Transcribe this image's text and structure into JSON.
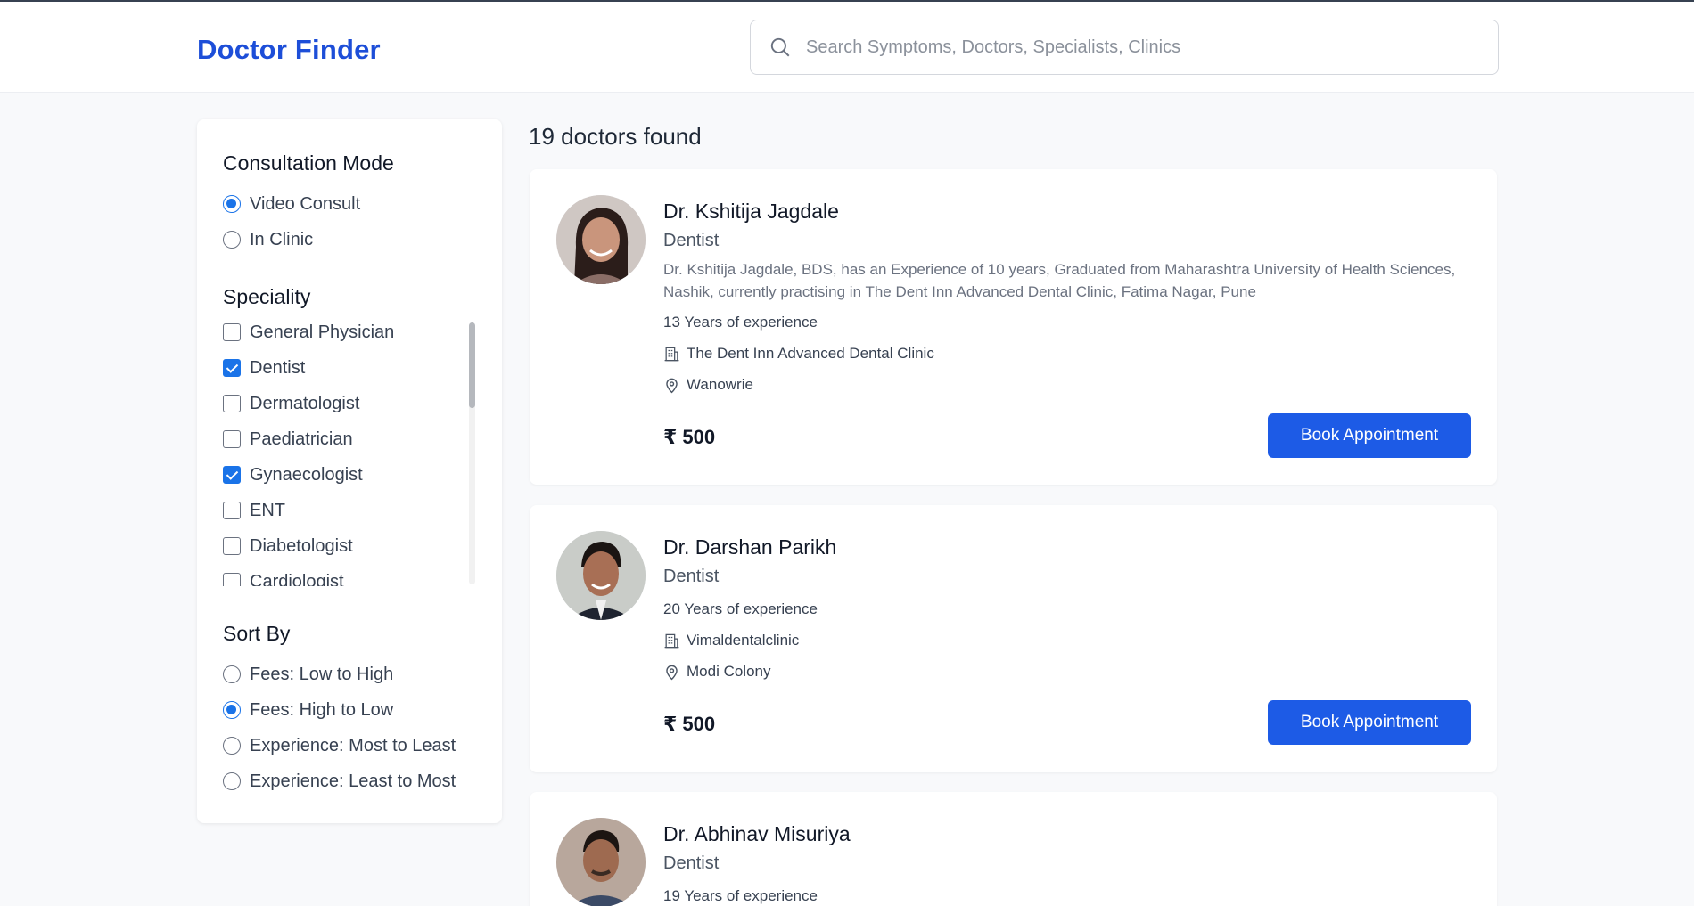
{
  "app": {
    "brand": "Doctor Finder"
  },
  "search": {
    "placeholder": "Search Symptoms, Doctors, Specialists, Clinics"
  },
  "filters": {
    "consultation": {
      "title": "Consultation Mode",
      "options": [
        {
          "label": "Video Consult",
          "checked": true
        },
        {
          "label": "In Clinic",
          "checked": false
        }
      ]
    },
    "speciality": {
      "title": "Speciality",
      "options": [
        {
          "label": "General Physician",
          "checked": false
        },
        {
          "label": "Dentist",
          "checked": true
        },
        {
          "label": "Dermatologist",
          "checked": false
        },
        {
          "label": "Paediatrician",
          "checked": false
        },
        {
          "label": "Gynaecologist",
          "checked": true
        },
        {
          "label": "ENT",
          "checked": false
        },
        {
          "label": "Diabetologist",
          "checked": false
        },
        {
          "label": "Cardiologist",
          "checked": false
        }
      ]
    },
    "sort": {
      "title": "Sort By",
      "options": [
        {
          "label": "Fees: Low to High",
          "checked": false
        },
        {
          "label": "Fees: High to Low",
          "checked": true
        },
        {
          "label": "Experience: Most to Least",
          "checked": false
        },
        {
          "label": "Experience: Least to Most",
          "checked": false
        }
      ]
    }
  },
  "results": {
    "count_label": "19 doctors found",
    "doctors": [
      {
        "name": "Dr. Kshitija Jagdale",
        "speciality": "Dentist",
        "description": "Dr. Kshitija Jagdale, BDS, has an Experience of 10 years, Graduated from Maharashtra University of Health Sciences, Nashik, currently practising in The Dent Inn Advanced Dental Clinic, Fatima Nagar, Pune",
        "experience": "13 Years of experience",
        "clinic": "The Dent Inn Advanced Dental Clinic",
        "location": "Wanowrie",
        "fee": "₹ 500",
        "button": "Book Appointment"
      },
      {
        "name": "Dr. Darshan Parikh",
        "speciality": "Dentist",
        "experience": "20 Years of experience",
        "clinic": "Vimaldentalclinic",
        "location": "Modi Colony",
        "fee": "₹ 500",
        "button": "Book Appointment"
      },
      {
        "name": "Dr. Abhinav Misuriya",
        "speciality": "Dentist",
        "experience": "19 Years of experience"
      }
    ]
  },
  "colors": {
    "brand": "#1d4ed8",
    "accent": "#1a73e8",
    "button": "#1d5be6"
  }
}
